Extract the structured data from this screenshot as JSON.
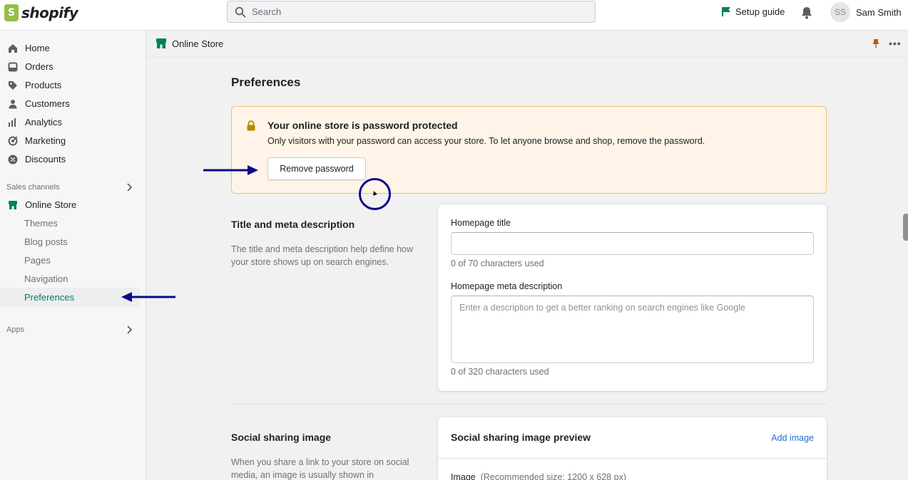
{
  "topbar": {
    "logo_text": "shopify",
    "search_placeholder": "Search",
    "setup_guide": "Setup guide",
    "user_initials": "SS",
    "user_name": "Sam Smith"
  },
  "sidebar": {
    "items": [
      {
        "label": "Home",
        "icon": "home-icon"
      },
      {
        "label": "Orders",
        "icon": "orders-icon"
      },
      {
        "label": "Products",
        "icon": "tag-icon"
      },
      {
        "label": "Customers",
        "icon": "person-icon"
      },
      {
        "label": "Analytics",
        "icon": "bar-chart-icon"
      },
      {
        "label": "Marketing",
        "icon": "target-icon"
      },
      {
        "label": "Discounts",
        "icon": "discount-icon"
      }
    ],
    "sales_channels_label": "Sales channels",
    "online_store_label": "Online Store",
    "sub_items": [
      "Themes",
      "Blog posts",
      "Pages",
      "Navigation",
      "Preferences"
    ],
    "apps_label": "Apps"
  },
  "page_header": {
    "title": "Online Store"
  },
  "main": {
    "title": "Preferences",
    "banner": {
      "title": "Your online store is password protected",
      "text": "Only visitors with your password can access your store. To let anyone browse and shop, remove the password.",
      "button": "Remove password"
    },
    "title_meta": {
      "heading": "Title and meta description",
      "description": "The title and meta description help define how your store shows up on search engines.",
      "homepage_title_label": "Homepage title",
      "homepage_title_value": "",
      "homepage_title_help": "0 of 70 characters used",
      "meta_label": "Homepage meta description",
      "meta_placeholder": "Enter a description to get a better ranking on search engines like Google",
      "meta_help": "0 of 320 characters used"
    },
    "social": {
      "heading": "Social sharing image",
      "description": "When you share a link to your store on social media, an image is usually shown in",
      "card_title": "Social sharing image preview",
      "add_image": "Add image",
      "image_label": "Image",
      "image_hint": "(Recommended size: 1200 x 628 px)"
    }
  },
  "colors": {
    "accent_green": "#008060",
    "banner_bg": "#fff4e7",
    "banner_border": "#eec07b",
    "annotation_blue": "#0a0a8a",
    "link_blue": "#2c6ecb"
  }
}
